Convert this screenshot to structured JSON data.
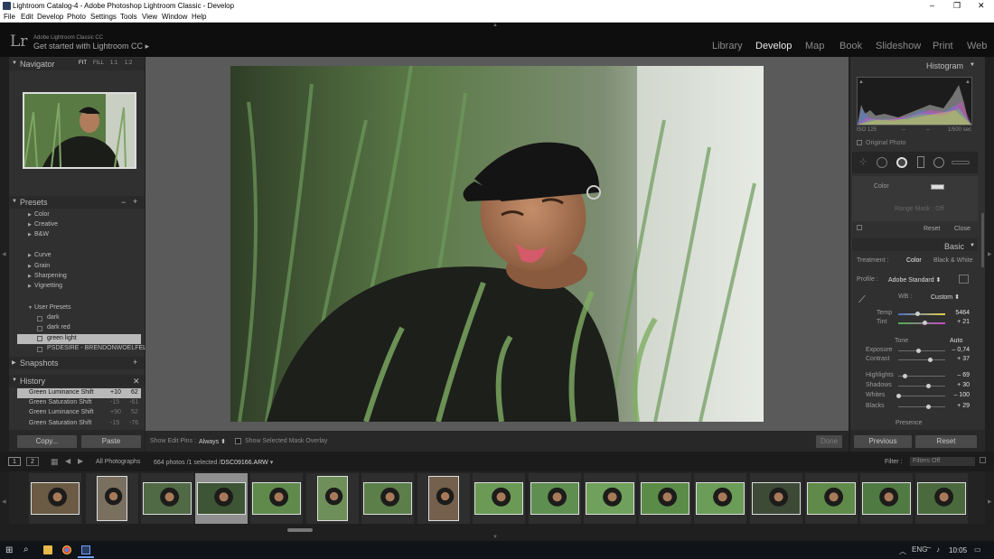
{
  "window": {
    "title": "Lightroom Catalog-4 - Adobe Photoshop Lightroom Classic - Develop",
    "minimize": "–",
    "maximize": "❐",
    "close": "✕"
  },
  "menu": [
    "File",
    "Edit",
    "Develop",
    "Photo",
    "Settings",
    "Tools",
    "View",
    "Window",
    "Help"
  ],
  "brand": {
    "logo": "Lr",
    "line1": "Adobe Lightroom Classic CC",
    "line2": "Get started with Lightroom CC",
    "arrow": "▸"
  },
  "modules": [
    "Library",
    "Develop",
    "Map",
    "Book",
    "Slideshow",
    "Print",
    "Web"
  ],
  "active_module": "Develop",
  "left": {
    "navigator": {
      "title": "Navigator",
      "opts": [
        "FIT",
        "FILL",
        "1:1",
        "1:2"
      ]
    },
    "presets": {
      "title": "Presets",
      "minus": "−",
      "plus": "+",
      "groups": [
        "Color",
        "Creative",
        "B&W",
        "Curve",
        "Grain",
        "Sharpening",
        "Vignetting",
        "User Presets"
      ],
      "user_presets": [
        "dark",
        "dark red",
        "green light",
        "PSDESIRE - BRENDONWOELFEL..."
      ]
    },
    "snapshots": {
      "title": "Snapshots",
      "plus": "+"
    },
    "history": {
      "title": "History",
      "close": "✕",
      "rows": [
        {
          "name": "Green Luminance Shift",
          "a": "+10",
          "b": "62"
        },
        {
          "name": "Green Saturation Shift",
          "a": "-15",
          "b": "-61"
        },
        {
          "name": "Green Luminance Shift",
          "a": "+90",
          "b": "52"
        },
        {
          "name": "Green Saturation Shift",
          "a": "-15",
          "b": "-76"
        }
      ]
    },
    "copy": "Copy...",
    "paste": "Paste"
  },
  "toolbar": {
    "show_edit_pins": "Show Edit Pins :",
    "pins_value": "Always",
    "mask_overlay": "Show Selected Mask Overlay",
    "done": "Done"
  },
  "right": {
    "histogram": {
      "title": "Histogram",
      "iso": "ISO 125",
      "mid1": "--",
      "mid2": "--",
      "shutter": "1/500 sec",
      "original": "Original Photo"
    },
    "color_label": "Color",
    "range_mask": "Range Mask : Off",
    "reset": "Reset",
    "close": "Close",
    "basic": {
      "title": "Basic",
      "treatment": "Treatment :",
      "color": "Color",
      "bw": "Black & White",
      "profile_label": "Profile :",
      "profile_value": "Adobe Standard",
      "wb_label": "WB :",
      "wb_value": "Custom",
      "tone": "Tone",
      "auto": "Auto",
      "presence": "Presence",
      "sliders": [
        {
          "label": "Temp",
          "value": "5464",
          "pos": 0.41
        },
        {
          "label": "Tint",
          "value": "+ 21",
          "pos": 0.56
        },
        {
          "label": "Exposure",
          "value": "– 0,74",
          "pos": 0.44
        },
        {
          "label": "Contrast",
          "value": "+ 37",
          "pos": 0.68
        },
        {
          "label": "Highlights",
          "value": "– 69",
          "pos": 0.15
        },
        {
          "label": "Shadows",
          "value": "+ 30",
          "pos": 0.65
        },
        {
          "label": "Whites",
          "value": "– 100",
          "pos": 0.0
        },
        {
          "label": "Blacks",
          "value": "+ 29",
          "pos": 0.64
        }
      ]
    },
    "previous": "Previous",
    "reset_btn": "Reset"
  },
  "filmstrip": {
    "view1": "1",
    "view2": "2",
    "source": "All Photographs",
    "count": "664 photos /1 selected /",
    "filename": "DSC09166.ARW",
    "filter_label": "Filter :",
    "filter_value": "Filters Off"
  },
  "taskbar": {
    "lang": "ENG",
    "time": "10:05"
  },
  "colors": {
    "panel": "#303030",
    "canvas": "#5a5a5a",
    "active_text": "#eaeaea"
  }
}
